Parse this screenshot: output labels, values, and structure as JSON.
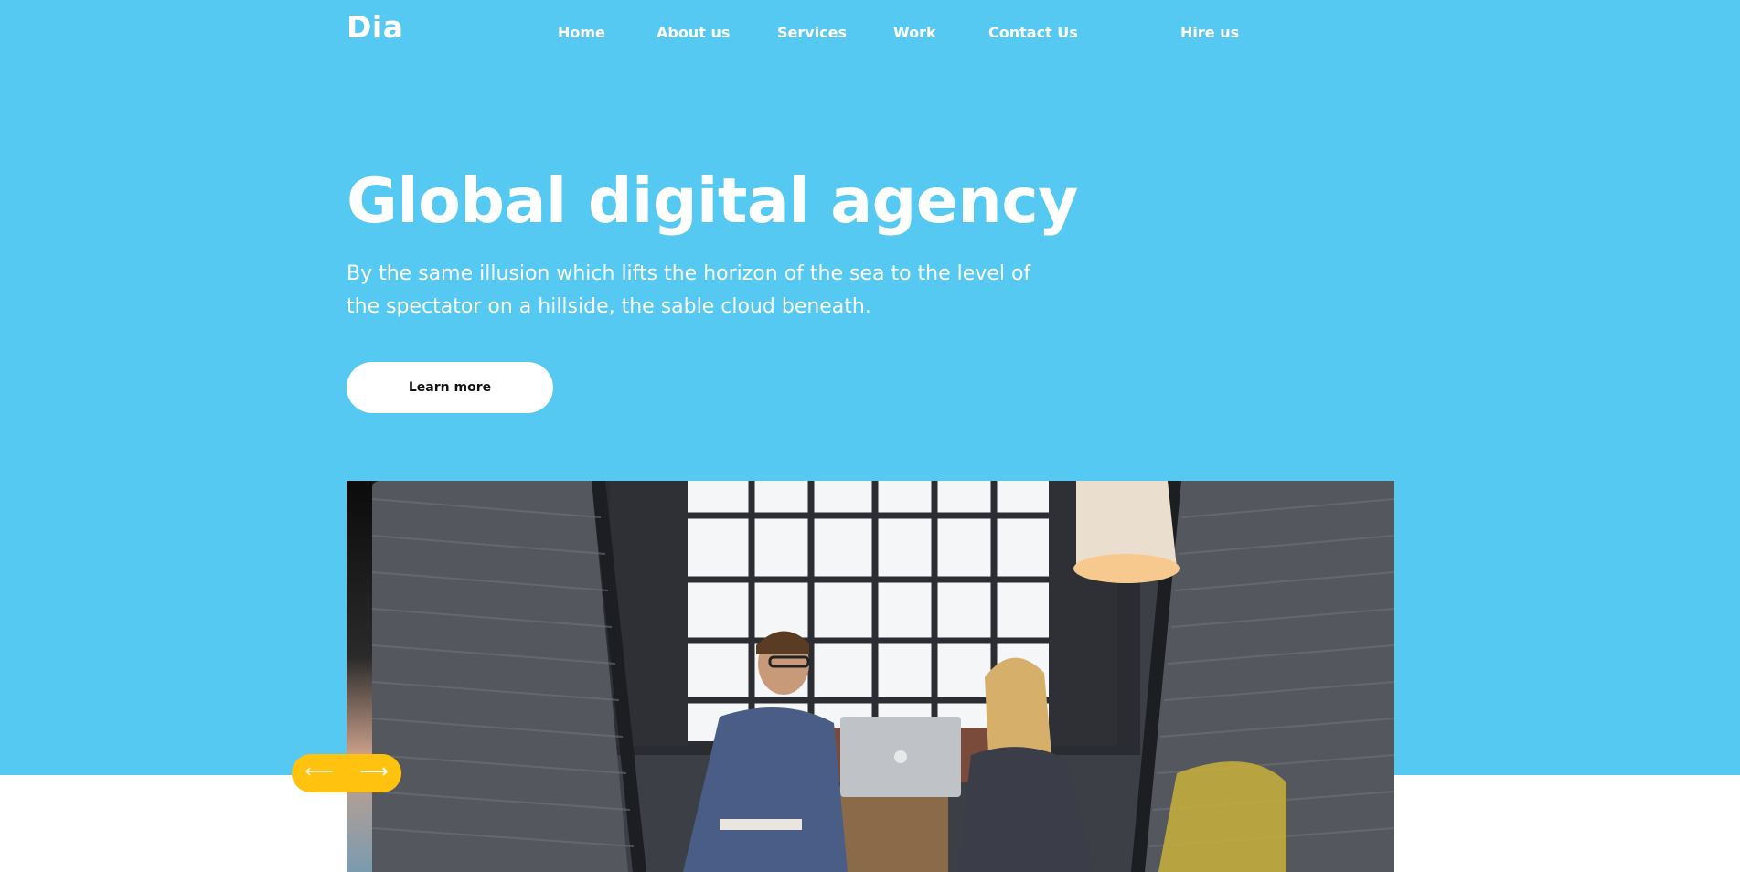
{
  "header": {
    "logo": "Dia",
    "nav": [
      {
        "label": "Home"
      },
      {
        "label": "About us"
      },
      {
        "label": "Services"
      },
      {
        "label": "Work"
      },
      {
        "label": "Contact Us"
      },
      {
        "label": "Hire us"
      }
    ]
  },
  "hero": {
    "title": "Global digital agency",
    "subtitle": "By the same illusion which lifts the horizon of the sea to the level of the spectator on a hillside, the sable cloud beneath.",
    "cta_label": "Learn more"
  },
  "slider": {
    "prev_arrow": "⟵",
    "next_arrow": "⟶",
    "image_description_icon": "photo-icon"
  },
  "colors": {
    "hero_background": "#55c9f2",
    "slider_controls": "#ffc20e",
    "text": "#ffffff"
  }
}
